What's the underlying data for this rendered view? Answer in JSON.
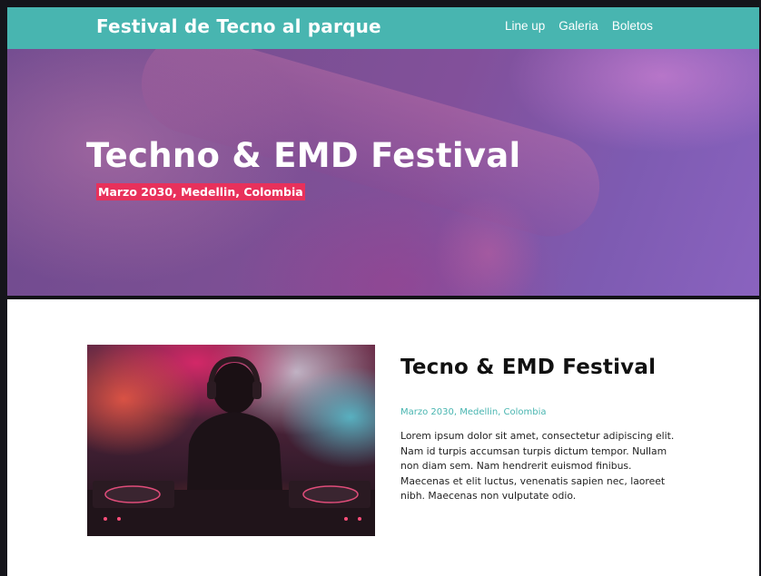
{
  "navbar": {
    "brand": "Festival de Tecno al parque",
    "links": [
      "Line up",
      "Galeria",
      "Boletos"
    ],
    "background": "#48b5b0"
  },
  "hero": {
    "title": "Techno & EMD Festival",
    "subtitle": "Marzo 2030, Medellin, Colombia",
    "subtitle_bg": "#e8315b",
    "image": "dj-hands-purple-photo"
  },
  "content": {
    "image": "dj-headphones-smoke-photo",
    "title": "Tecno & EMD Festival",
    "date": "Marzo 2030, Medellin, Colombia",
    "body": "Lorem ipsum dolor sit amet, consectetur adipiscing elit. Nam id turpis accumsan turpis dictum tempor. Nullam non diam sem. Nam hendrerit euismod finibus. Maecenas et elit luctus, venenatis sapien nec, laoreet nibh. Maecenas non vulputate odio.",
    "accent": "#48b5b0"
  }
}
